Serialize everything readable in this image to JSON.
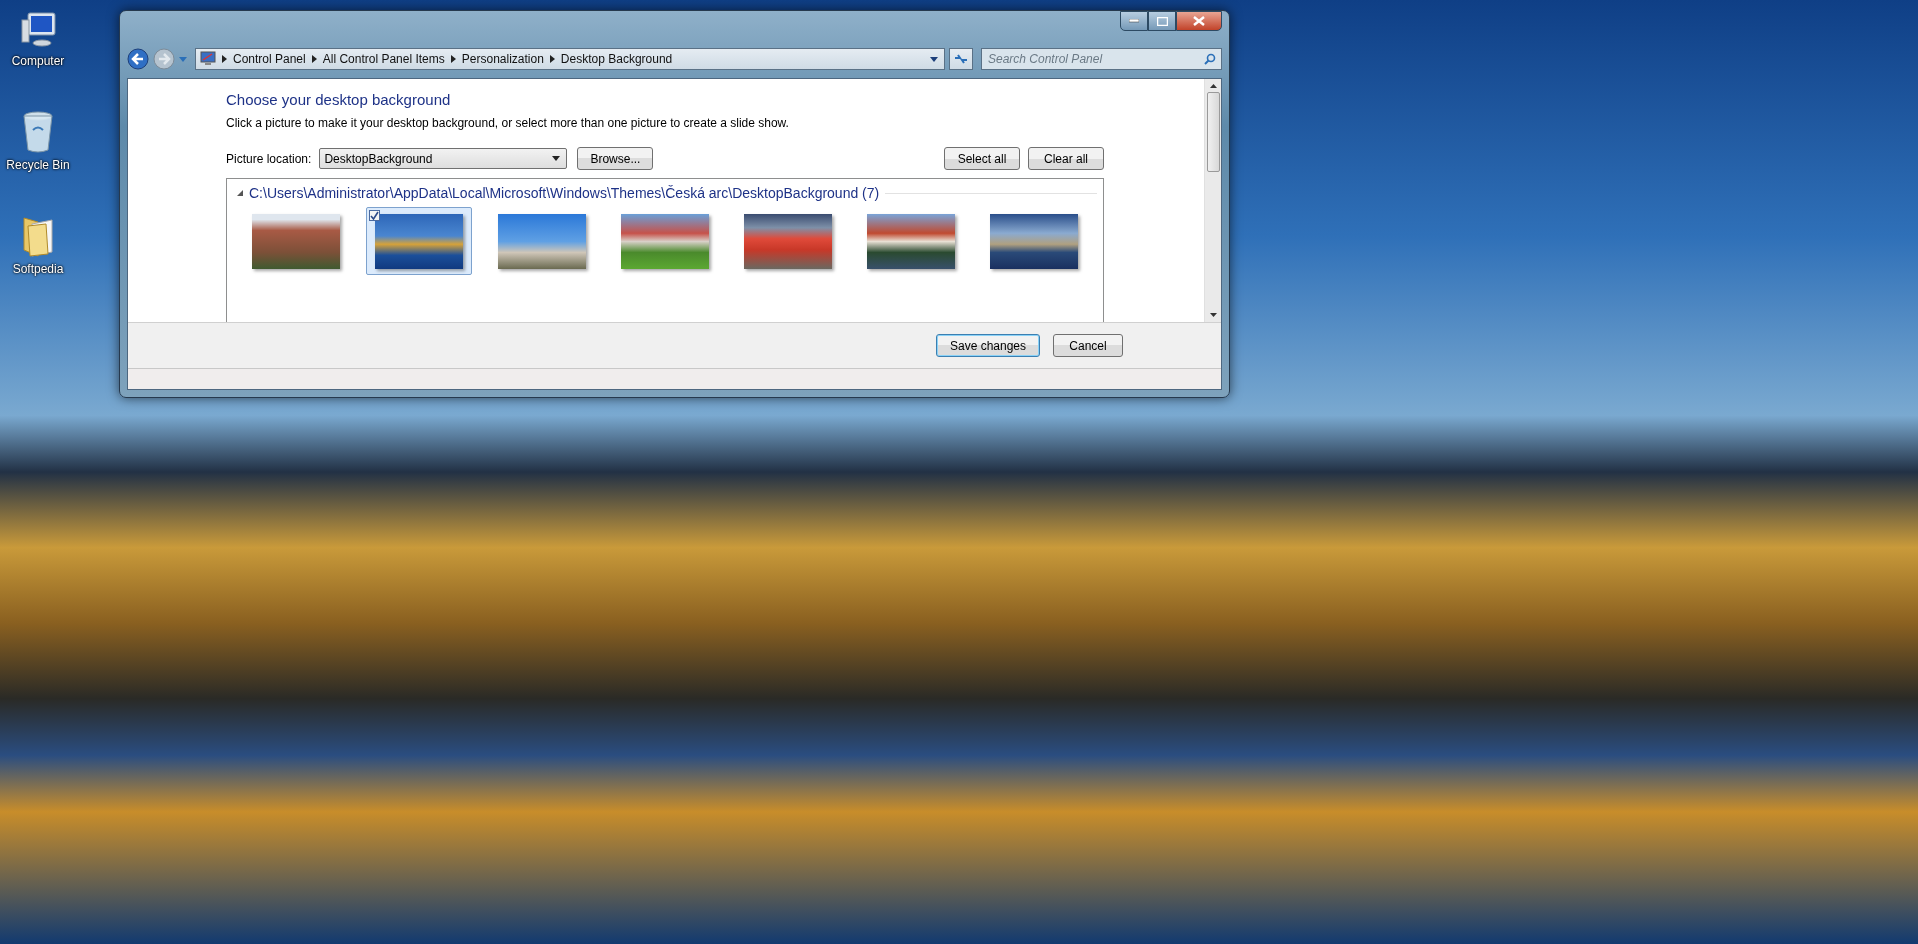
{
  "desktop_icons": [
    {
      "label": "Computer",
      "kind": "computer"
    },
    {
      "label": "Recycle Bin",
      "kind": "bin"
    },
    {
      "label": "Softpedia",
      "kind": "folder"
    }
  ],
  "window": {
    "breadcrumb": [
      "Control Panel",
      "All Control Panel Items",
      "Personalization",
      "Desktop Background"
    ],
    "search": {
      "placeholder": "Search Control Panel"
    },
    "heading": "Choose your desktop background",
    "description": "Click a picture to make it your desktop background, or select more than one picture to create a slide show.",
    "picture_location": {
      "label": "Picture location:",
      "value": "DesktopBackground"
    },
    "browse_button": "Browse...",
    "selection_buttons": [
      "Select all",
      "Clear all"
    ],
    "group": {
      "title": "C:\\Users\\Administrator\\AppData\\Local\\Microsoft\\Windows\\Themes\\Česká arc\\DesktopBackground (7)",
      "expanded": true,
      "pictures": [
        {
          "selected": false,
          "checked": false
        },
        {
          "selected": true,
          "checked": true
        },
        {
          "selected": false,
          "checked": false
        },
        {
          "selected": false,
          "checked": false
        },
        {
          "selected": false,
          "checked": false
        },
        {
          "selected": false,
          "checked": false
        },
        {
          "selected": false,
          "checked": false
        }
      ]
    },
    "footer_buttons": [
      "Save changes",
      "Cancel"
    ]
  }
}
